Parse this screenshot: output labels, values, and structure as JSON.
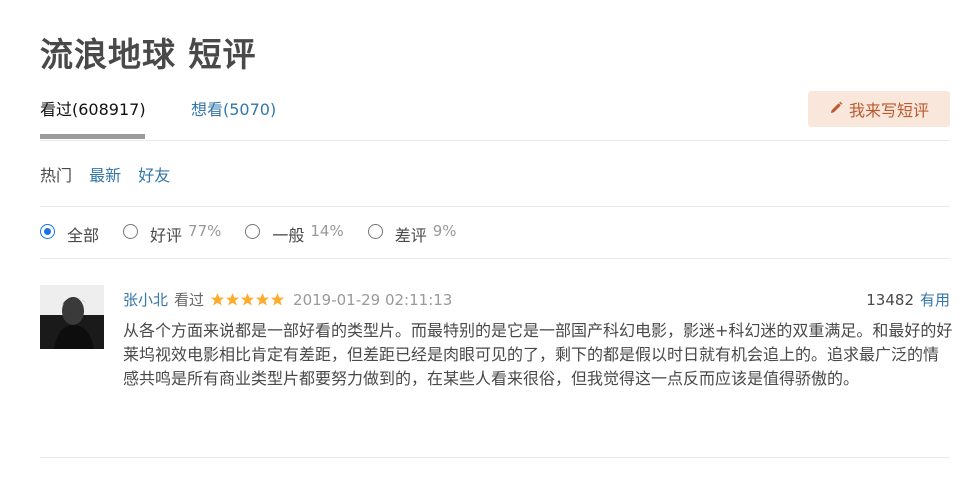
{
  "page": {
    "title": "流浪地球 短评"
  },
  "tabs": [
    {
      "label": "看过(608917)",
      "active": true
    },
    {
      "label": "想看(5070)",
      "active": false
    }
  ],
  "write_button": {
    "label": "我来写短评",
    "icon": "pencil-icon"
  },
  "sort": {
    "hot": "热门",
    "latest": "最新",
    "friends": "好友"
  },
  "filters": [
    {
      "label": "全部",
      "percent": "",
      "checked": true
    },
    {
      "label": "好评",
      "percent": "77%",
      "checked": false
    },
    {
      "label": "一般",
      "percent": "14%",
      "checked": false
    },
    {
      "label": "差评",
      "percent": "9%",
      "checked": false
    }
  ],
  "comment": {
    "author": "张小北",
    "status": "看过",
    "rating": 5,
    "time": "2019-01-29 02:11:13",
    "votes": "13482",
    "useful_label": "有用",
    "text": "从各个方面来说都是一部好看的类型片。而最特别的是它是一部国产科幻电影，影迷+科幻迷的双重满足。和最好的好莱坞视效电影相比肯定有差距，但差距已经是肉眼可见的了，剩下的都是假以时日就有机会追上的。追求最广泛的情感共鸣是所有商业类型片都要努力做到的，在某些人看来很俗，但我觉得这一点反而应该是值得骄傲的。"
  },
  "colors": {
    "link": "#3377aa",
    "star": "#ffac2d",
    "write_bg": "#fae7dc",
    "write_text": "#bb5a2e"
  }
}
